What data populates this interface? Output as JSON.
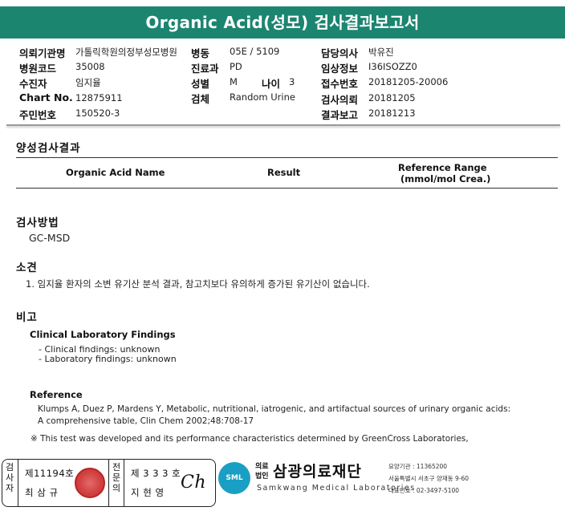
{
  "title": "Organic Acid(성모) 검사결과보고서",
  "header": {
    "hospital_label": "의뢰기관명",
    "hospital_value": "가톨릭학원의정부성모병원",
    "hospital_code_label": "병원코드",
    "hospital_code_value": "35008",
    "patient_label": "수진자",
    "patient_value": "임지율",
    "chart_label": "Chart No.",
    "chart_value": "12875911",
    "ssn_label": "주민번호",
    "ssn_value": "150520-3",
    "ward_label": "병동",
    "ward_value": "05E / 5109",
    "dept_label": "진료과",
    "dept_value": "PD",
    "sex_label": "성별",
    "sex_value": "M",
    "age_label": "나이",
    "age_value": "3",
    "specimen_label": "검체",
    "specimen_value": "Random Urine",
    "doctor_label": "담당의사",
    "doctor_value": "박유진",
    "clinical_label": "임상정보",
    "clinical_value": "I36ISOZZ0",
    "receipt_label": "접수번호",
    "receipt_value": "20181205-20006",
    "request_label": "검사의뢰",
    "request_value": "20181205",
    "report_label": "결과보고",
    "report_value": "20181213"
  },
  "positive_section": {
    "title": "양성검사결과",
    "col_name": "Organic Acid Name",
    "col_result": "Result",
    "col_ref_line1": "Reference Range",
    "col_ref_line2": "(mmol/mol Crea.)"
  },
  "method": {
    "title": "검사방법",
    "value": "GC-MSD"
  },
  "findings": {
    "title": "소견",
    "item1": "1. 임지율 환자의 소변 유기산 분석 결과, 참고치보다 유의하게 증가된 유기산이 없습니다."
  },
  "remarks": {
    "title": "비고",
    "clinical_title": "Clinical Laboratory Findings",
    "clinical_item1": "- Clinical findings: unknown",
    "clinical_item2": "- Laboratory findings: unknown",
    "reference_title": "Reference",
    "reference_line1": "Klumps A, Duez P, Mardens Y, Metabolic, nutritional, iatrogenic, and artifactual sources of urinary organic acids:",
    "reference_line2": "A comprehensive table, Clin Chem 2002;48:708-17",
    "note": "※ This test was developed and its performance characteristics determined by GreenCross Laboratories,"
  },
  "footer": {
    "inspector_label": "검사자",
    "inspector_license": "제11194호",
    "inspector_name": "최 삼 규",
    "specialist_label": "전문의",
    "specialist_license": "제 3 3 3 호",
    "specialist_name": "지 현 영",
    "signature": "Ch",
    "logo_text": "SML",
    "org_type1": "의료",
    "org_type2": "법인",
    "org_name": "삼광의료재단",
    "org_en": "Samkwang Medical Laboratories",
    "info_line1": "요양기관 : 11365200",
    "info_line2": "서울특별시 서초구 양재동 9-60",
    "info_line3": "대표번호 : 02-3497-5100"
  },
  "colors": {
    "title_bar": "#1b8570",
    "logo": "#1a9fc4",
    "seal": "#d24141"
  }
}
